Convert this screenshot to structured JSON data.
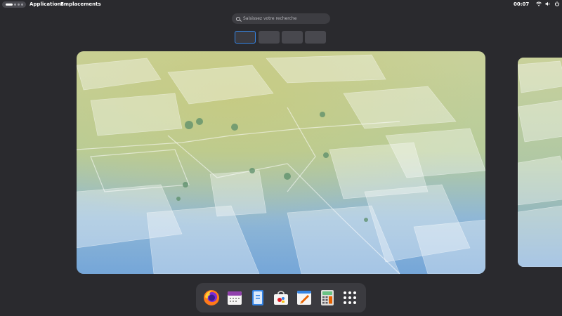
{
  "topbar": {
    "applications_label": "Applications",
    "places_label": "Emplacements",
    "clock": "00:07",
    "tray_icons": [
      "wifi-icon",
      "volume-icon",
      "power-icon"
    ]
  },
  "search": {
    "placeholder": "Saisissez votre recherche"
  },
  "workspaces": {
    "count": 4,
    "active_index": 0
  },
  "dock": {
    "apps": [
      {
        "name": "Firefox",
        "icon": "firefox-icon"
      },
      {
        "name": "Calendar",
        "icon": "calendar-icon"
      },
      {
        "name": "Notes",
        "icon": "notes-icon"
      },
      {
        "name": "Software",
        "icon": "software-icon"
      },
      {
        "name": "Text Editor",
        "icon": "text-editor-icon"
      },
      {
        "name": "Calculator",
        "icon": "calculator-icon"
      },
      {
        "name": "Show Applications",
        "icon": "app-grid-icon"
      }
    ]
  },
  "colors": {
    "accent": "#3584e4",
    "background": "#2a2a2e"
  }
}
